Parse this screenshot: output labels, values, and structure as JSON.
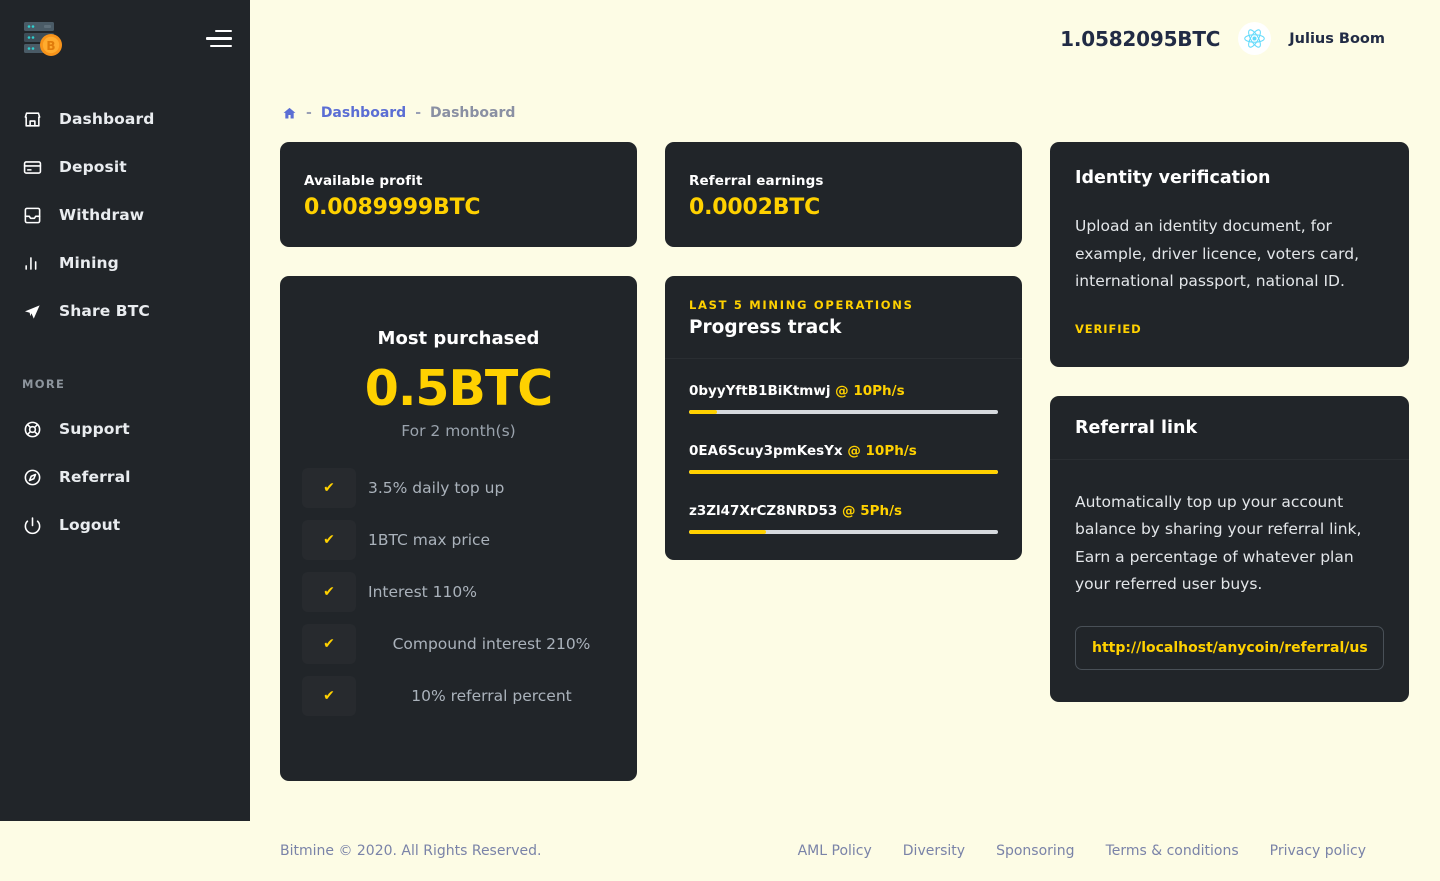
{
  "sidebar": {
    "logo_icon": "server-bitcoin-logo",
    "menu_toggle_icon": "hamburger-menu-icon",
    "items": [
      {
        "label": "Dashboard",
        "icon": "store-icon"
      },
      {
        "label": "Deposit",
        "icon": "credit-card-icon"
      },
      {
        "label": "Withdraw",
        "icon": "inbox-icon"
      },
      {
        "label": "Mining",
        "icon": "bar-chart-icon"
      },
      {
        "label": "Share BTC",
        "icon": "send-icon"
      }
    ],
    "section_label": "MORE",
    "more_items": [
      {
        "label": "Support",
        "icon": "lifebuoy-icon"
      },
      {
        "label": "Referral",
        "icon": "compass-icon"
      },
      {
        "label": "Logout",
        "icon": "power-icon"
      }
    ]
  },
  "topbar": {
    "balance": "1.0582095BTC",
    "avatar_icon": "react-logo-avatar",
    "username": "Julius Boom"
  },
  "breadcrumb": {
    "home_icon": "home-icon",
    "separator": "-",
    "link": "Dashboard",
    "current": "Dashboard"
  },
  "stats": [
    {
      "label": "Available profit",
      "value": "0.0089999BTC"
    },
    {
      "label": "Referral earnings",
      "value": "0.0002BTC"
    }
  ],
  "plan": {
    "title": "Most purchased",
    "amount": "0.5BTC",
    "period": "For 2 month(s)",
    "check_icon": "check-icon",
    "features": [
      "3.5% daily top up",
      "1BTC max price",
      "Interest 110%",
      "Compound interest 210%",
      "10% referral percent"
    ]
  },
  "progress": {
    "kicker": "LAST 5 MINING OPERATIONS",
    "title": "Progress track",
    "operations": [
      {
        "id": "0byyYftB1BiKtmwj",
        "rate": "@ 10Ph/s",
        "percent": 9
      },
      {
        "id": "0EA6Scuy3pmKesYx",
        "rate": "@ 10Ph/s",
        "percent": 100
      },
      {
        "id": "z3Zl47XrCZ8NRD53",
        "rate": "@ 5Ph/s",
        "percent": 25
      }
    ]
  },
  "identity": {
    "heading": "Identity verification",
    "text": "Upload an identity document, for example, driver licence, voters card, international passport, national ID.",
    "badge": "VERIFIED"
  },
  "referral": {
    "heading": "Referral link",
    "text": "Automatically top up your account balance by sharing your referral link, Earn a percentage of whatever plan your referred user buys.",
    "link_value": "http://localhost/anycoin/referral/user"
  },
  "footer": {
    "copyright": "Bitmine © 2020. All Rights Reserved.",
    "links": [
      "AML Policy",
      "Diversity",
      "Sponsoring",
      "Terms & conditions",
      "Privacy policy"
    ]
  },
  "colors": {
    "accent": "#FFD100",
    "dark": "#212529",
    "background": "#FDFCE5",
    "link": "#5b6ed4"
  }
}
